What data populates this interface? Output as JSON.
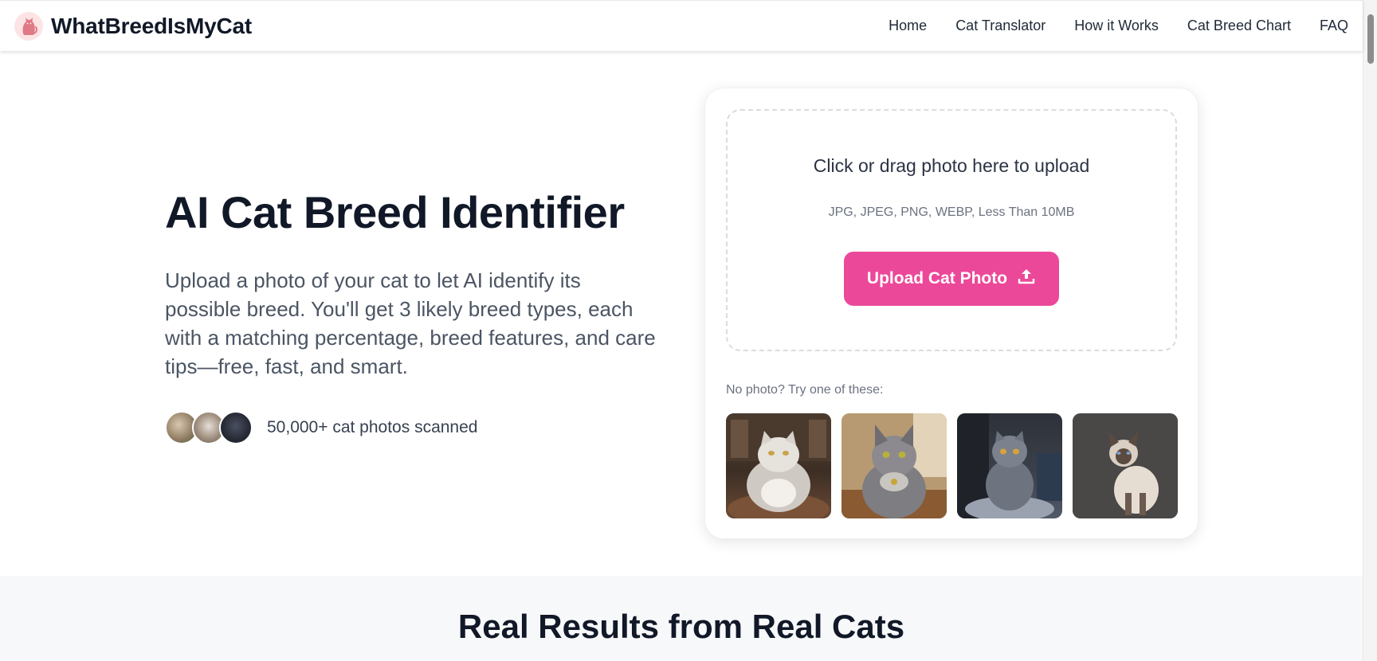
{
  "header": {
    "brand_name": "WhatBreedIsMyCat",
    "nav": [
      "Home",
      "Cat Translator",
      "How it Works",
      "Cat Breed Chart",
      "FAQ"
    ]
  },
  "hero": {
    "title": "AI Cat Breed Identifier",
    "description": "Upload a photo of your cat to let AI identify its possible breed. You'll get 3 likely breed types, each with a matching percentage, breed features, and care tips—free, fast, and smart.",
    "social_proof": "50,000+ cat photos scanned"
  },
  "upload": {
    "title": "Click or drag photo here to upload",
    "formats": "JPG, JPEG, PNG, WEBP, Less Than 10MB",
    "button_label": "Upload Cat Photo",
    "try_text": "No photo? Try one of these:"
  },
  "section": {
    "title": "Real Results from Real Cats"
  },
  "colors": {
    "accent": "#ec4899",
    "text": "#111827",
    "muted": "#6b7280"
  }
}
